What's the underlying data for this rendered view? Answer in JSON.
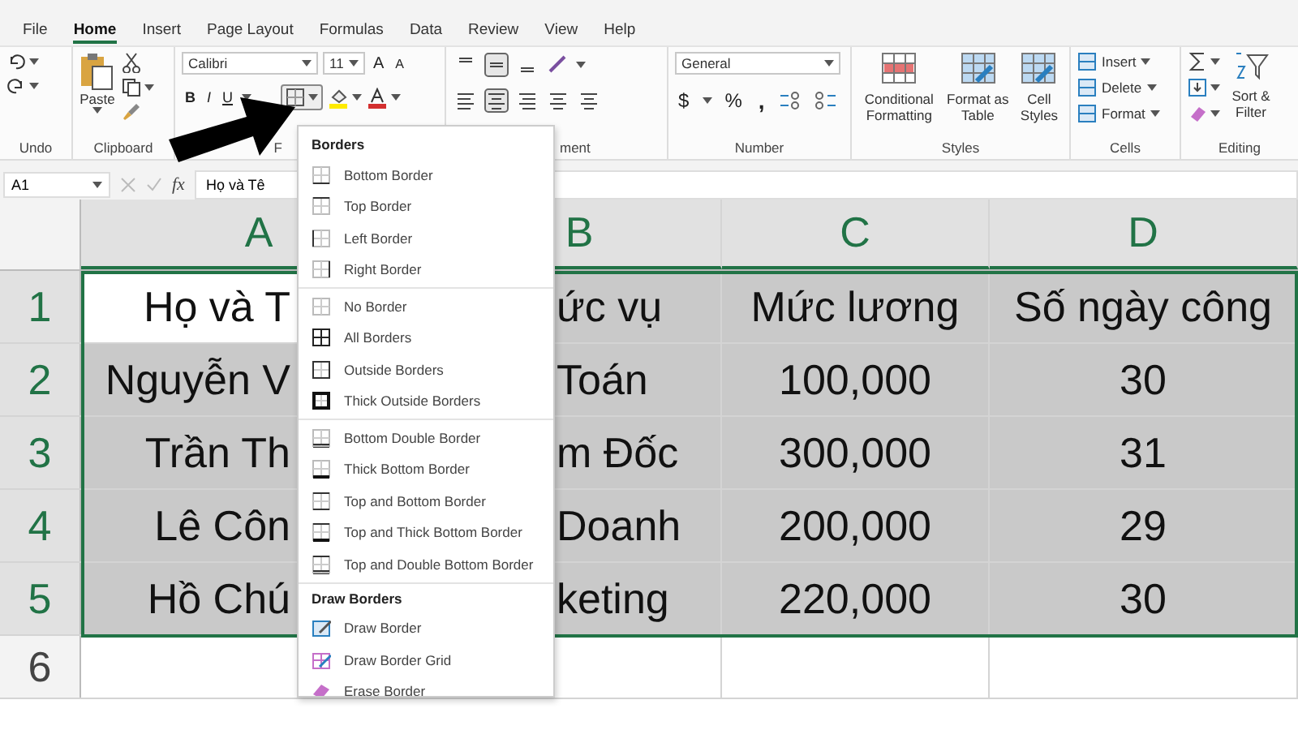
{
  "tabs": [
    {
      "label": "File",
      "selected": false
    },
    {
      "label": "Home",
      "selected": true
    },
    {
      "label": "Insert",
      "selected": false
    },
    {
      "label": "Page Layout",
      "selected": false
    },
    {
      "label": "Formulas",
      "selected": false
    },
    {
      "label": "Data",
      "selected": false
    },
    {
      "label": "Review",
      "selected": false
    },
    {
      "label": "View",
      "selected": false
    },
    {
      "label": "Help",
      "selected": false
    }
  ],
  "ribbon": {
    "groups": [
      "Undo",
      "Clipboard",
      "F",
      "ment",
      "Number",
      "Styles",
      "Cells",
      "Editing"
    ],
    "paste": "Paste",
    "font_name": "Calibri",
    "font_size": "11",
    "bold": "B",
    "italic": "I",
    "underline": "U",
    "grow": "A",
    "shrink": "A",
    "number_format": "General",
    "currency": "$",
    "percent": "%",
    "comma": ",",
    "styles": [
      "Conditional Formatting",
      "Format as Table",
      "Cell Styles"
    ],
    "cells": [
      "Insert",
      "Delete",
      "Format"
    ],
    "sort": "Sort & Filter"
  },
  "formula_bar": {
    "name_box": "A1",
    "function_label": "fx",
    "value": "Họ và Tê"
  },
  "sheet": {
    "columns": [
      {
        "label": "A",
        "selected": true
      },
      {
        "label": "B",
        "selected": true
      },
      {
        "label": "C",
        "selected": true
      },
      {
        "label": "D",
        "selected": true
      }
    ],
    "rows": [
      {
        "header": "1",
        "selected": true,
        "cells": [
          {
            "text": "Họ và T",
            "active": true
          },
          {
            "text": "ức vụ",
            "active": false
          },
          {
            "text": "Mức lương",
            "active": false
          },
          {
            "text": "Số ngày công",
            "active": false
          }
        ]
      },
      {
        "header": "2",
        "selected": true,
        "cells": [
          {
            "text": "Nguyễn V",
            "active": false
          },
          {
            "text": "Toán",
            "active": false
          },
          {
            "text": "100,000",
            "active": false
          },
          {
            "text": "30",
            "active": false
          }
        ]
      },
      {
        "header": "3",
        "selected": true,
        "cells": [
          {
            "text": "Trần Th",
            "active": false
          },
          {
            "text": "m Đốc",
            "active": false
          },
          {
            "text": "300,000",
            "active": false
          },
          {
            "text": "31",
            "active": false
          }
        ]
      },
      {
        "header": "4",
        "selected": true,
        "cells": [
          {
            "text": "Lê Côn",
            "active": false
          },
          {
            "text": "Doanh",
            "active": false
          },
          {
            "text": "200,000",
            "active": false
          },
          {
            "text": "29",
            "active": false
          }
        ]
      },
      {
        "header": "5",
        "selected": true,
        "cells": [
          {
            "text": "Hồ Chú",
            "active": false
          },
          {
            "text": "keting",
            "active": false
          },
          {
            "text": "220,000",
            "active": false
          },
          {
            "text": "30",
            "active": false
          }
        ]
      },
      {
        "header": "6",
        "selected": false,
        "cells": []
      }
    ]
  },
  "borders_menu": {
    "sections": [
      {
        "title": "Borders",
        "groups": [
          [
            {
              "label": "Bottom Border",
              "kind": "bottom"
            },
            {
              "label": "Top Border",
              "kind": "top"
            },
            {
              "label": "Left Border",
              "kind": "left"
            },
            {
              "label": "Right Border",
              "kind": "right"
            }
          ],
          [
            {
              "label": "No Border",
              "kind": "none"
            },
            {
              "label": "All Borders",
              "kind": "all"
            },
            {
              "label": "Outside Borders",
              "kind": "outside"
            },
            {
              "label": "Thick Outside Borders",
              "kind": "thick-outside"
            }
          ],
          [
            {
              "label": "Bottom Double Border",
              "kind": "bottom-double"
            },
            {
              "label": "Thick Bottom Border",
              "kind": "thick-bottom"
            },
            {
              "label": "Top and Bottom Border",
              "kind": "top-bottom"
            },
            {
              "label": "Top and Thick Bottom Border",
              "kind": "top-thick-bottom"
            },
            {
              "label": "Top and Double Bottom Border",
              "kind": "top-double-bottom"
            }
          ]
        ]
      },
      {
        "title": "Draw Borders",
        "groups": [
          [
            {
              "label": "Draw Border",
              "kind": "draw"
            },
            {
              "label": "Draw Border Grid",
              "kind": "draw-grid"
            },
            {
              "label": "Erase Border",
              "kind": "erase"
            }
          ]
        ]
      }
    ]
  }
}
